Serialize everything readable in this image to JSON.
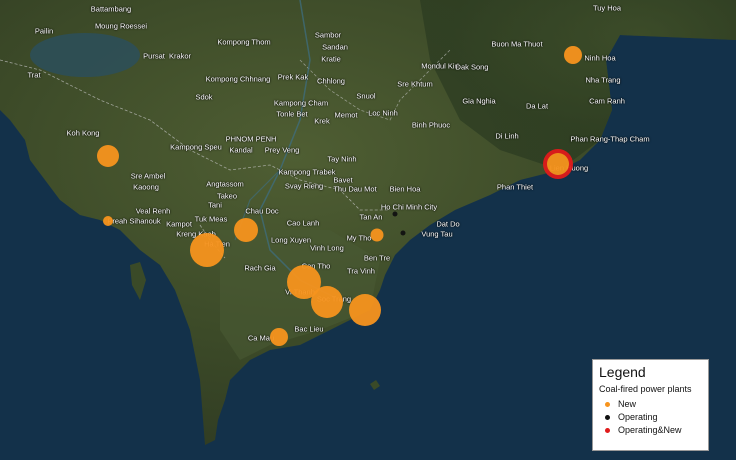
{
  "legend": {
    "title": "Legend",
    "subtitle": "Coal-fired power plants",
    "items": [
      {
        "label": "New",
        "color": "#f7941d"
      },
      {
        "label": "Operating",
        "color": "#111111"
      },
      {
        "label": "Operating&New",
        "color": "#e01b1b"
      }
    ]
  },
  "places": [
    "Battambang",
    "Moung Roessei",
    "Pailin",
    "Pursat",
    "Krakor",
    "Kompong Thom",
    "Sambor",
    "Sandan",
    "Kratie",
    "Buon Ma Thuot",
    "Tuy Hoa",
    "Ninh Hoa",
    "Nha Trang",
    "Cam Ranh",
    "Trat",
    "Kompong Chhnang",
    "Prek Kak",
    "Chhlong",
    "Mondul Kiri",
    "Dak Song",
    "Sdok",
    "Snuol",
    "Sre Khtum",
    "Gia Nghia",
    "Da Lat",
    "Kampong Cham",
    "Tonle Bet",
    "Krek",
    "Memot",
    "Loc Ninh",
    "Binh Phuoc",
    "Koh Kong",
    "PHNOM PENH",
    "Kandal",
    "Prey Veng",
    "Di Linh",
    "Phan Rang-Thap Cham",
    "Kampong Speu",
    "Tay Ninh",
    "Lien Huong",
    "Sre Ambel",
    "Kaoong",
    "Kampong Trabek",
    "Svay Rieng",
    "Bavet",
    "Thu Dau Mot",
    "Bien Hoa",
    "Phan Thiet",
    "Angtassom",
    "Takeo",
    "Tani",
    "Veal Renh",
    "Preah Sihanouk",
    "Kampot",
    "Tuk Meas",
    "Chau Doc",
    "Cao Lanh",
    "Tan An",
    "Ho Chi Minh City",
    "Kreng Kaeb",
    "Ha Tien",
    "Long Xuyen",
    "My Tho",
    "Dat Do",
    "Vung Tau",
    "Vinh Long",
    "Ben Tre",
    "Rach Gia",
    "Can Tho",
    "Tra Vinh",
    "Vi Thanh",
    "Soc Trang",
    "Bac Lieu",
    "Ca Mau"
  ],
  "plants": [
    {
      "name": "Ninh Hoa",
      "status": "New",
      "size": 18
    },
    {
      "name": "Koh Kong",
      "status": "New",
      "size": 22
    },
    {
      "name": "Preah Sihanouk",
      "status": "New",
      "size": 10
    },
    {
      "name": "Ha Tien",
      "status": "New",
      "size": 34
    },
    {
      "name": "Kampot",
      "status": "New",
      "size": 24
    },
    {
      "name": "My Tho",
      "status": "New",
      "size": 13
    },
    {
      "name": "Can Tho",
      "status": "New",
      "size": 34
    },
    {
      "name": "Soc Trang",
      "status": "New",
      "size": 32
    },
    {
      "name": "Tra Vinh",
      "status": "New",
      "size": 32
    },
    {
      "name": "Ca Mau",
      "status": "New",
      "size": 18
    },
    {
      "name": "Ho Chi Minh City",
      "status": "Operating",
      "size": 5
    },
    {
      "name": "Dat Do",
      "status": "Operating",
      "size": 5
    },
    {
      "name": "Lien Huong",
      "status": "Operating&New",
      "size": 22
    }
  ]
}
